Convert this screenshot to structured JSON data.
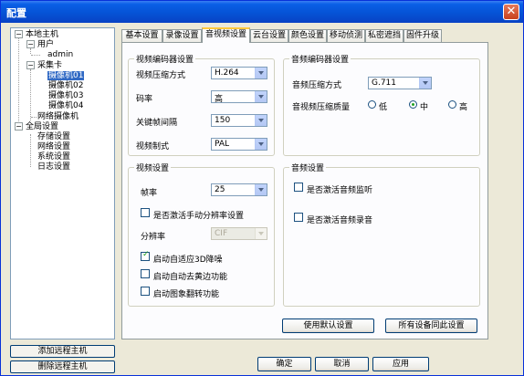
{
  "window": {
    "title": "配置"
  },
  "tree": {
    "local_host": "本地主机",
    "users": "用户",
    "admin": "admin",
    "capture_card": "采集卡",
    "cameras": [
      "摄像机01",
      "摄像机02",
      "摄像机03",
      "摄像机04"
    ],
    "network_camera": "网络摄像机",
    "global_settings": "全局设置",
    "storage": "存储设置",
    "network": "网络设置",
    "system": "系统设置",
    "log": "日志设置"
  },
  "sidebar": {
    "add_remote": "添加远程主机",
    "delete_remote": "删除远程主机"
  },
  "tabs": [
    "基本设置",
    "录像设置",
    "音视频设置",
    "云台设置",
    "颜色设置",
    "移动侦测",
    "私密遮挡",
    "固件升级"
  ],
  "video_encoder": {
    "title": "视频编码器设置",
    "compression_label": "视频压缩方式",
    "compression_value": "H.264",
    "bitrate_label": "码率",
    "bitrate_value": "高",
    "keyframe_label": "关键帧间隔",
    "keyframe_value": "150",
    "standard_label": "视频制式",
    "standard_value": "PAL"
  },
  "audio_encoder": {
    "title": "音频编码器设置",
    "compression_label": "音频压缩方式",
    "compression_value": "G.711",
    "quality_label": "音视频压缩质量",
    "quality_options": [
      "低",
      "中",
      "高"
    ],
    "quality_selected": "中"
  },
  "video_settings": {
    "title": "视频设置",
    "framerate_label": "帧率",
    "framerate_value": "25",
    "manual_res_label": "是否激活手动分辨率设置",
    "resolution_label": "分辨率",
    "resolution_value": "CIF",
    "denoise_label": "启动自适应3D降噪",
    "edge_label": "启动自动去黄边功能",
    "flip_label": "启动图象翻转功能",
    "checks": {
      "manual_res": false,
      "denoise": true,
      "edge": false,
      "flip": false
    }
  },
  "audio_settings": {
    "title": "音频设置",
    "monitor_label": "是否激活音频监听",
    "record_label": "是否激活音频录音",
    "checks": {
      "monitor": false,
      "record": false
    }
  },
  "actions": {
    "use_default": "使用默认设置",
    "sync_all": "所有设备同此设置",
    "ok": "确定",
    "cancel": "取消",
    "apply": "应用"
  },
  "colors": {
    "titlebar": "#0553d6",
    "selection": "#316ac5",
    "face": "#ece9d8",
    "active_tab": "#ffc83c"
  }
}
